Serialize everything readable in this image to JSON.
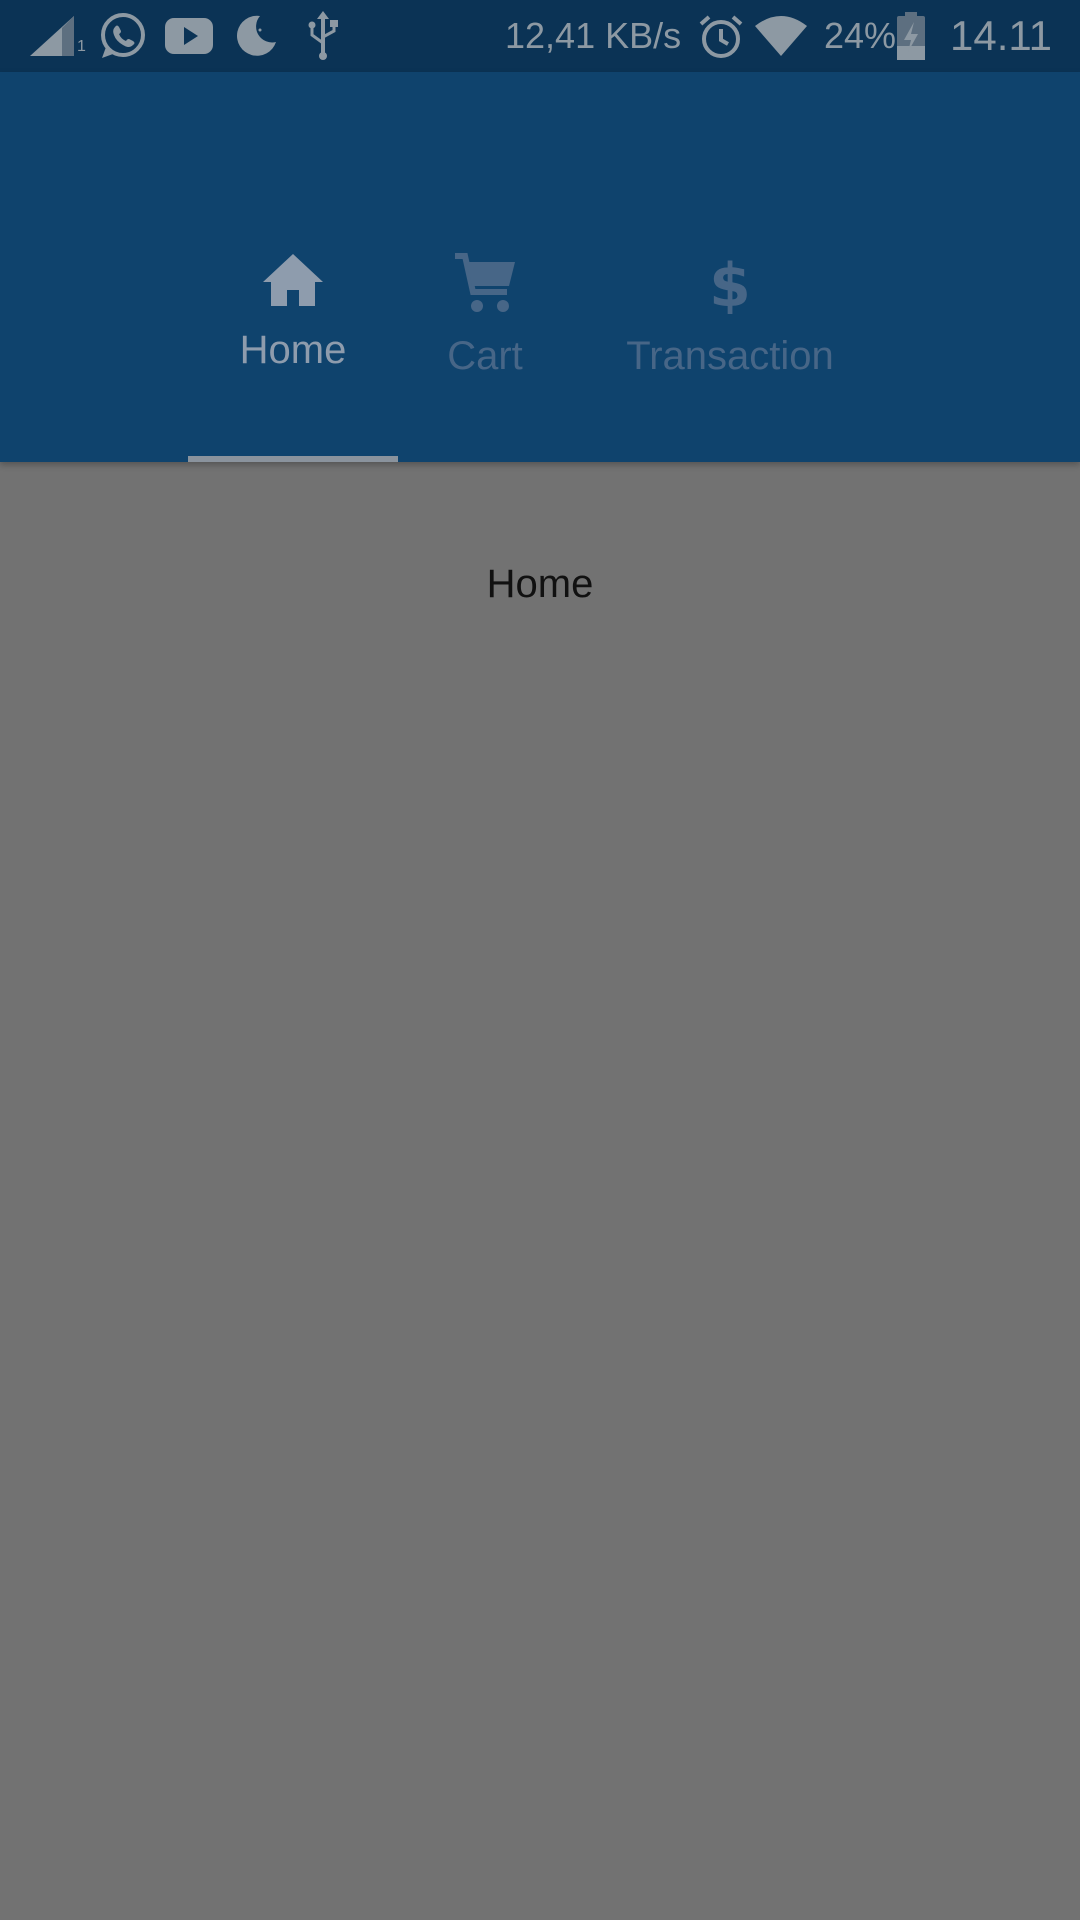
{
  "status_bar": {
    "network_speed": "12,41 KB/s",
    "battery": "24%",
    "time": "14.11",
    "sim_slot": "1",
    "icons": [
      "signal-icon",
      "whatsapp-icon",
      "youtube-icon",
      "night-mode-icon",
      "usb-icon",
      "alarm-icon",
      "wifi-icon",
      "battery-charging-icon"
    ]
  },
  "tabs": [
    {
      "label": "Home",
      "icon": "home-icon",
      "selected": true
    },
    {
      "label": "Cart",
      "icon": "cart-icon",
      "selected": false
    },
    {
      "label": "Transaction",
      "icon": "dollar-icon",
      "selected": false
    }
  ],
  "content": {
    "title": "Home"
  },
  "colors": {
    "status_bar": "#0b3355",
    "app_bar": "#0f436d",
    "scrim_background": "#727272",
    "tab_active": "#8e9cad",
    "tab_inactive": "#476687",
    "indicator": "#8a939d"
  }
}
